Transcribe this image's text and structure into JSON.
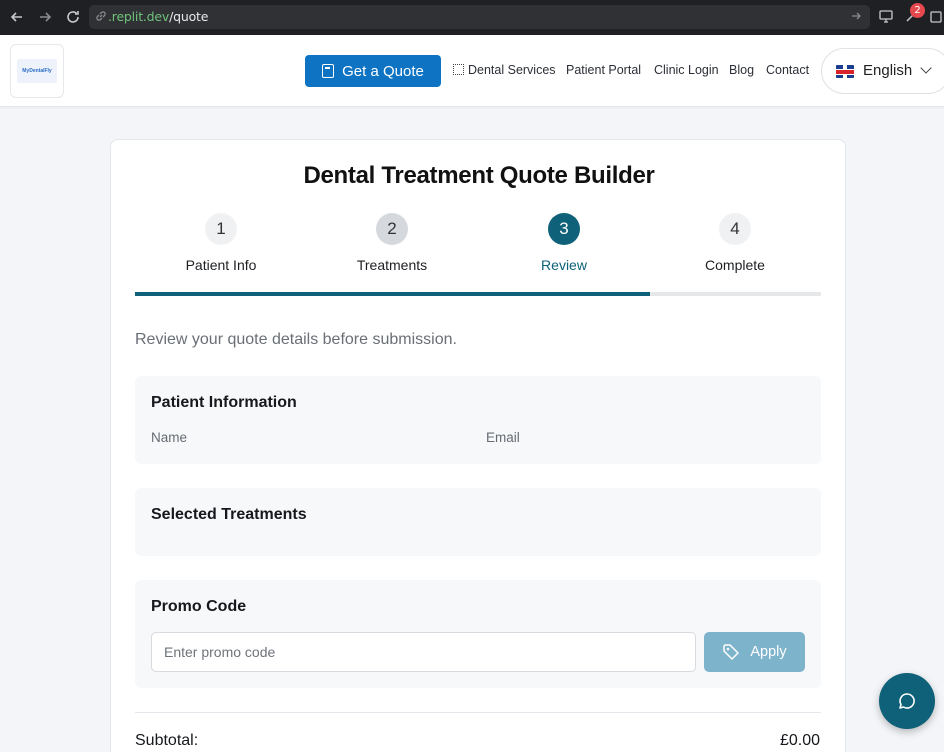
{
  "browser": {
    "url_host": ".replit.dev",
    "url_path": "/quote",
    "notification_count": "2",
    "icons": [
      "back-arrow-icon",
      "forward-arrow-icon",
      "reload-icon",
      "link-icon",
      "go-arrow-icon",
      "monitor-icon",
      "extension-icon",
      "external-link-icon"
    ]
  },
  "header": {
    "logo_text": "MyDentalFly",
    "quote_button": "Get a Quote",
    "nav": [
      "Dental Services",
      "Patient Portal",
      "Clinic Login",
      "Blog",
      "Contact"
    ],
    "language": "English"
  },
  "page": {
    "title": "Dental Treatment Quote Builder",
    "steps": [
      {
        "number": "1",
        "label": "Patient Info",
        "state": "upcoming"
      },
      {
        "number": "2",
        "label": "Treatments",
        "state": "done"
      },
      {
        "number": "3",
        "label": "Review",
        "state": "active"
      },
      {
        "number": "4",
        "label": "Complete",
        "state": "upcoming"
      }
    ],
    "progress_percent": 75,
    "intro": "Review your quote details before submission."
  },
  "patient_info": {
    "title": "Patient Information",
    "name_label": "Name",
    "email_label": "Email"
  },
  "treatments": {
    "title": "Selected Treatments"
  },
  "promo": {
    "title": "Promo Code",
    "placeholder": "Enter promo code",
    "value": "",
    "apply_label": "Apply"
  },
  "summary": {
    "subtotal_label": "Subtotal:",
    "subtotal_value": "£0.00"
  },
  "colors": {
    "primary_teal": "#0e6178",
    "quote_button_blue": "#0e73c2",
    "apply_disabled": "#7db4cc"
  }
}
